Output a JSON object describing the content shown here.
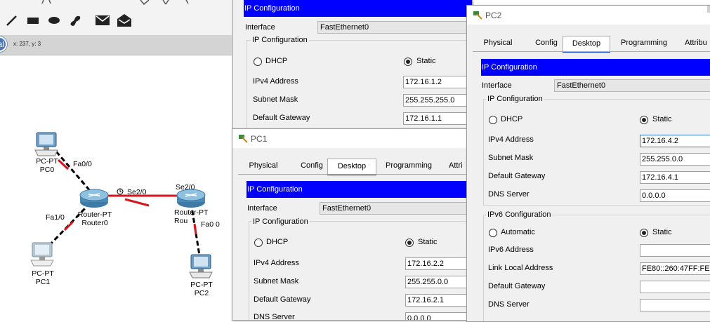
{
  "workspace": {
    "coordinates": "x: 237, y: 3",
    "mode_label": "al",
    "devices": {
      "pc0": {
        "type": "PC-PT",
        "name": "PC0"
      },
      "pc1": {
        "type": "PC-PT",
        "name": "PC1"
      },
      "pc2": {
        "type": "PC-PT",
        "name": "PC2"
      },
      "router0": {
        "type": "Router-PT",
        "name": "Router0"
      },
      "router1": {
        "type": "Router-PT",
        "name": "Rou"
      }
    },
    "ports": {
      "fa00_pc0": "Fa0/0",
      "fa10": "Fa1/0",
      "se20_left": "Se2/0",
      "se20_right": "Se2/0",
      "fa0_right": "Fa0",
      "fa0_right_suffix": "0"
    },
    "toolbar_icons": [
      "line-tool-icon",
      "rectangle-tool-icon",
      "ellipse-tool-icon",
      "freeform-tool-icon",
      "envelope-icon",
      "open-envelope-icon"
    ],
    "colors": {
      "link": "#000000",
      "link_down": "#d9141c",
      "device_blue": "#4a8ab5"
    }
  },
  "window_back": {
    "header": "IP Configuration",
    "interface_label": "Interface",
    "interface_value": "FastEthernet0",
    "group_title": "IP Configuration",
    "dhcp_label": "DHCP",
    "static_label": "Static",
    "ipv4_label": "IPv4 Address",
    "ipv4_value": "172.16.1.2",
    "mask_label": "Subnet Mask",
    "mask_value": "255.255.255.0",
    "gateway_label": "Default Gateway",
    "gateway_value": "172.16.1.1"
  },
  "window_pc1": {
    "title": "PC1",
    "tabs": [
      "Physical",
      "Config",
      "Desktop",
      "Programming",
      "Attri"
    ],
    "active_tab": "Desktop",
    "header": "IP Configuration",
    "interface_label": "Interface",
    "interface_value": "FastEthernet0",
    "group_title": "IP Configuration",
    "dhcp_label": "DHCP",
    "static_label": "Static",
    "ipv4_label": "IPv4 Address",
    "ipv4_value": "172.16.2.2",
    "mask_label": "Subnet Mask",
    "mask_value": "255.255.0.0",
    "gateway_label": "Default Gateway",
    "gateway_value": "172.16.2.1",
    "dns_label": "DNS Server",
    "dns_value": "0.0.0.0"
  },
  "window_pc2": {
    "title": "PC2",
    "tabs": [
      "Physical",
      "Config",
      "Desktop",
      "Programming",
      "Attribu"
    ],
    "active_tab": "Desktop",
    "header": "IP Configuration",
    "interface_label": "Interface",
    "interface_value": "FastEthernet0",
    "group_title": "IP Configuration",
    "dhcp_label": "DHCP",
    "static_label": "Static",
    "ipv4_label": "IPv4 Address",
    "ipv4_value": "172.16.4.2",
    "mask_label": "Subnet Mask",
    "mask_value": "255.255.0.0",
    "gateway_label": "Default Gateway",
    "gateway_value": "172.16.4.1",
    "dns_label": "DNS Server",
    "dns_value": "0.0.0.0",
    "ipv6_group_title": "IPv6 Configuration",
    "automatic_label": "Automatic",
    "static6_label": "Static",
    "ipv6_label": "IPv6 Address",
    "ipv6_value": "",
    "link_local_label": "Link Local Address",
    "link_local_value": "FE80::260:47FF:FE",
    "gateway6_label": "Default Gateway",
    "gateway6_value": "",
    "dns6_label": "DNS Server",
    "dns6_value": ""
  }
}
